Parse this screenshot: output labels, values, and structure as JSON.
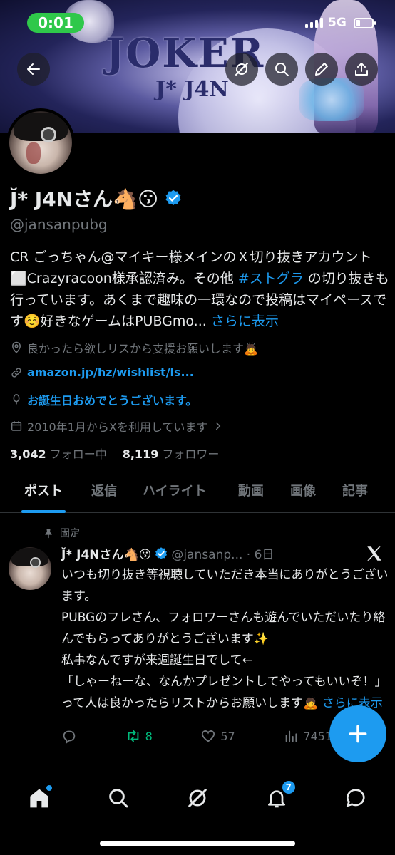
{
  "status_bar": {
    "time": "0:01",
    "network": "5G"
  },
  "banner": {
    "logo_text": "JOKER",
    "logo_sub": "J* J4N"
  },
  "profile": {
    "name": "J̆* J4Nさん🐴😗",
    "handle": "@jansanpubg",
    "bio_part1": "CR ごっちゃん@マイキー様メインのＸ切り抜きアカウント⬜Crazyracoon様承認済み。その他 ",
    "bio_tag": "#ストグラ",
    "bio_part2": " の切り抜きも行っています。あくまで趣味の一環なので投稿はマイペースです☺️好きなゲームはPUBGmo... ",
    "bio_more": "さらに表示",
    "location": "良かったら欲しリスから支援お願いします🙇",
    "website": "amazon.jp/hz/wishlist/ls...",
    "birthday": "お誕生日おめでとうございます。",
    "joined": "2010年1月からXを利用しています",
    "following_count": "3,042",
    "following_label": "フォロー中",
    "followers_count": "8,119",
    "followers_label": "フォロワー"
  },
  "tabs": [
    "ポスト",
    "返信",
    "ハイライト",
    "動画",
    "画像",
    "記事"
  ],
  "post": {
    "pinned_label": "固定",
    "author": "J̆* J4Nさん🐴😗",
    "handle_time": "@jansanp... · 6日",
    "body": "いつも切り抜き等視聴していただき本当にありがとうございます。\nPUBGのフレさん、フォロワーさんも遊んでいただいたり絡んでもらってありがとうございます✨\n私事なんですが来週誕生日でして←\n「しゃーねーな、なんかプレゼントしてやってもいいぞ！」って人は良かったらリストからお願いします🙇 ",
    "more": "さらに表示",
    "retweets": "8",
    "likes": "57",
    "views": "7451"
  },
  "nav": {
    "notifications_badge": "7"
  },
  "colors": {
    "accent": "#1d9bf0",
    "retweet": "#00ba7c",
    "muted": "#71767b",
    "status_pill": "#2fc84a"
  }
}
